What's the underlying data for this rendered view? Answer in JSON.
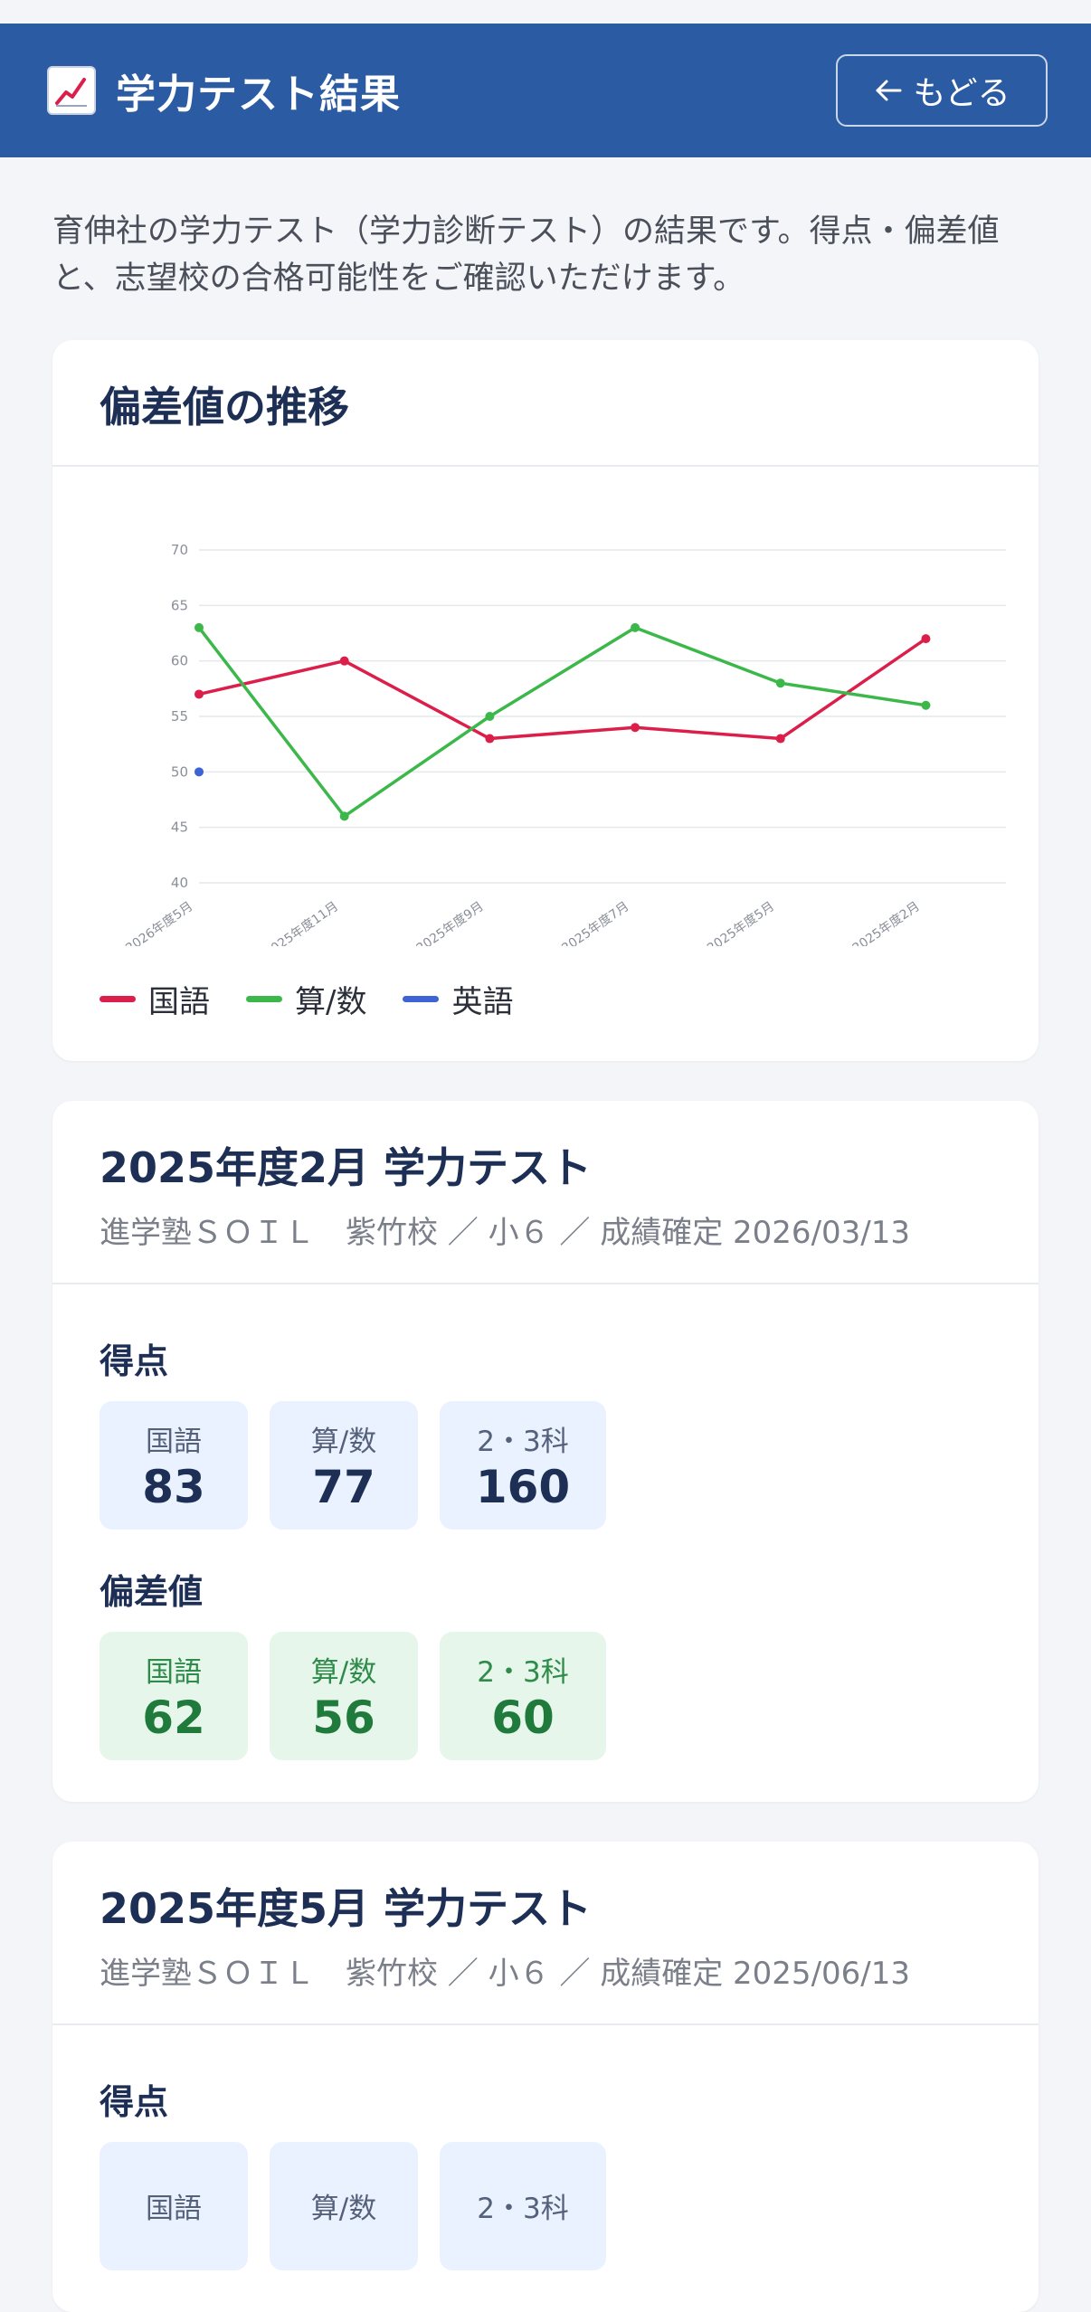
{
  "header": {
    "title": "学力テスト結果",
    "back_label": "もどる",
    "icon": "chart-increasing-icon",
    "color": "#2b5ba3"
  },
  "intro": "育伸社の学力テスト（学力診断テスト）の結果です。得点・偏差値と、志望校の合格可能性をご確認いただけます。",
  "chart_card": {
    "title": "偏差値の推移",
    "legend": [
      {
        "label": "国語",
        "color": "#dc1f4a"
      },
      {
        "label": "算/数",
        "color": "#3cb84a"
      },
      {
        "label": "英語",
        "color": "#3d63d6"
      }
    ]
  },
  "chart_data": {
    "type": "line",
    "x": [
      "2026年度5月",
      "2025年度11月",
      "2025年度9月",
      "2025年度7月",
      "2025年度5月",
      "2025年度2月"
    ],
    "ylim": [
      40,
      70
    ],
    "yticks": [
      40,
      45,
      50,
      55,
      60,
      65,
      70
    ],
    "grid": true,
    "legend_position": "bottom-left",
    "series": [
      {
        "name": "国語",
        "color": "#dc1f4a",
        "values": [
          57,
          60,
          53,
          54,
          53,
          62
        ]
      },
      {
        "name": "算/数",
        "color": "#3cb84a",
        "values": [
          63,
          46,
          55,
          63,
          58,
          56
        ]
      },
      {
        "name": "英語",
        "color": "#3d63d6",
        "values": [
          50,
          null,
          null,
          null,
          null,
          null
        ]
      }
    ]
  },
  "tests": [
    {
      "title": "2025年度2月 学力テスト",
      "subtitle": "進学塾ＳＯＩＬ　紫竹校 ／ 小６ ／ 成績確定 2026/03/13",
      "score_label": "得点",
      "scores": [
        {
          "label": "国語",
          "value": "83"
        },
        {
          "label": "算/数",
          "value": "77"
        },
        {
          "label": "2・3科",
          "value": "160"
        }
      ],
      "dev_label": "偏差値",
      "devs": [
        {
          "label": "国語",
          "value": "62"
        },
        {
          "label": "算/数",
          "value": "56"
        },
        {
          "label": "2・3科",
          "value": "60"
        }
      ]
    },
    {
      "title": "2025年度5月 学力テスト",
      "subtitle": "進学塾ＳＯＩＬ　紫竹校 ／ 小６ ／ 成績確定 2025/06/13",
      "score_label": "得点",
      "scores": [
        {
          "label": "国語",
          "value": ""
        },
        {
          "label": "算/数",
          "value": ""
        },
        {
          "label": "2・3科",
          "value": ""
        }
      ]
    }
  ]
}
